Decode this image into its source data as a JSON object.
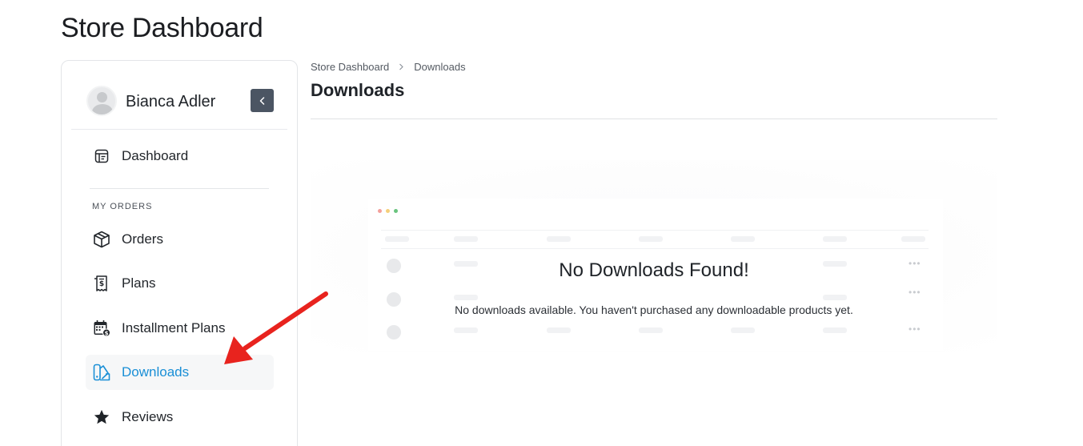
{
  "page": {
    "title": "Store Dashboard"
  },
  "sidebar": {
    "user_name": "Bianca Adler",
    "dashboard_label": "Dashboard",
    "section_label": "MY ORDERS",
    "items": [
      {
        "label": "Orders",
        "icon": "box-icon"
      },
      {
        "label": "Plans",
        "icon": "receipt-icon"
      },
      {
        "label": "Installment Plans",
        "icon": "calendar-icon"
      },
      {
        "label": "Downloads",
        "icon": "download-files-icon",
        "active": true
      },
      {
        "label": "Reviews",
        "icon": "star-icon"
      }
    ]
  },
  "breadcrumb": {
    "root": "Store Dashboard",
    "current": "Downloads"
  },
  "content": {
    "title": "Downloads",
    "empty_title": "No Downloads Found!",
    "empty_desc": "No downloads available. You haven't purchased any downloadable products yet."
  },
  "colors": {
    "accent": "#1a8fd6",
    "annotation_arrow": "#e8231e",
    "collapse_button": "#4b5563"
  }
}
